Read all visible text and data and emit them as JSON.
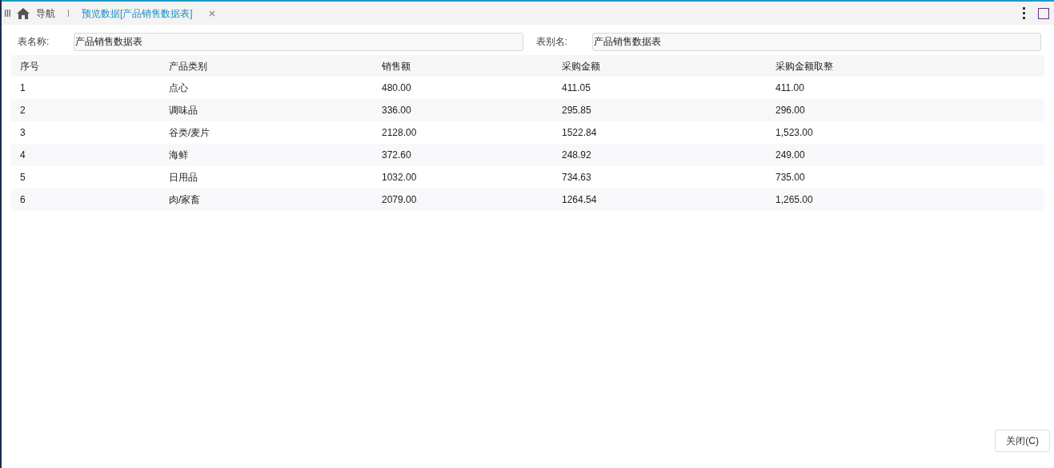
{
  "tabs": [
    {
      "label": "导航",
      "selected": false,
      "closable": false
    },
    {
      "label": "预览数据[产品销售数据表]",
      "selected": true,
      "closable": true
    }
  ],
  "fields": [
    {
      "label": "表名称:",
      "value": "产品销售数据表"
    },
    {
      "label": "表别名:",
      "value": "产品销售数据表"
    }
  ],
  "table": {
    "columns": [
      "序号",
      "产品类别",
      "销售额",
      "采购金额",
      "采购金额取整"
    ],
    "rows": [
      [
        "1",
        "点心",
        "480.00",
        "411.05",
        "411.00"
      ],
      [
        "2",
        "调味品",
        "336.00",
        "295.85",
        "296.00"
      ],
      [
        "3",
        "谷类/麦片",
        "2128.00",
        "1522.84",
        "1,523.00"
      ],
      [
        "4",
        "海鲜",
        "372.60",
        "248.92",
        "249.00"
      ],
      [
        "5",
        "日用品",
        "1032.00",
        "734.63",
        "735.00"
      ],
      [
        "6",
        "肉/家畜",
        "2079.00",
        "1264.54",
        "1,265.00"
      ]
    ]
  },
  "buttons": [
    "关闭(C)"
  ]
}
